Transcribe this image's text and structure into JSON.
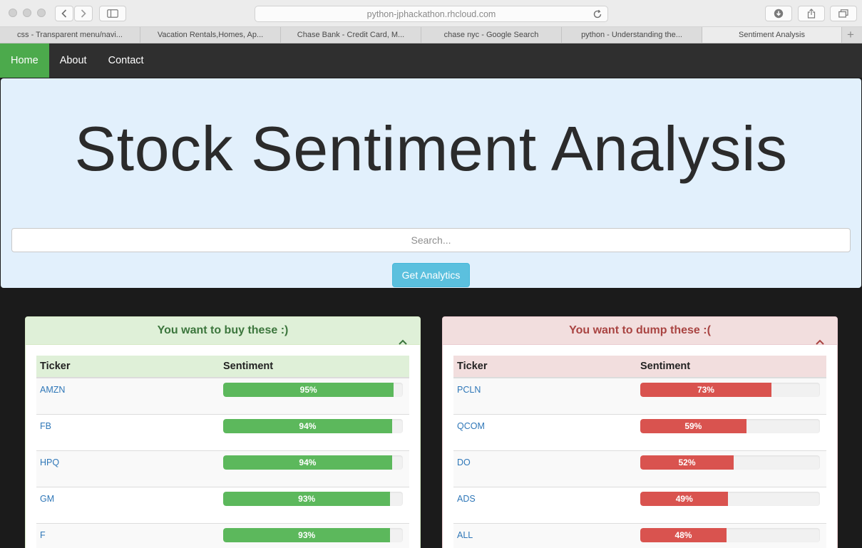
{
  "browser": {
    "url": "python-jphackathon.rhcloud.com",
    "tabs": [
      {
        "label": "css - Transparent menu/navi..."
      },
      {
        "label": "Vacation Rentals,Homes, Ap..."
      },
      {
        "label": "Chase Bank - Credit Card, M..."
      },
      {
        "label": "chase nyc - Google Search"
      },
      {
        "label": "python - Understanding the..."
      },
      {
        "label": "Sentiment Analysis"
      }
    ],
    "new_tab": "+"
  },
  "nav": {
    "items": [
      {
        "label": "Home"
      },
      {
        "label": "About"
      },
      {
        "label": "Contact"
      }
    ]
  },
  "hero": {
    "title": "Stock Sentiment Analysis",
    "search_placeholder": "Search...",
    "button_label": "Get Analytics"
  },
  "buy_panel": {
    "title": "You want to buy these :)",
    "col_ticker": "Ticker",
    "col_sentiment": "Sentiment",
    "color": "#5cb85c",
    "rows": [
      {
        "ticker": "AMZN",
        "pct": 95,
        "label": "95%"
      },
      {
        "ticker": "FB",
        "pct": 94,
        "label": "94%"
      },
      {
        "ticker": "HPQ",
        "pct": 94,
        "label": "94%"
      },
      {
        "ticker": "GM",
        "pct": 93,
        "label": "93%"
      },
      {
        "ticker": "F",
        "pct": 93,
        "label": "93%"
      }
    ]
  },
  "dump_panel": {
    "title": "You want to dump these :(",
    "col_ticker": "Ticker",
    "col_sentiment": "Sentiment",
    "color": "#d9534f",
    "rows": [
      {
        "ticker": "PCLN",
        "pct": 73,
        "label": "73%"
      },
      {
        "ticker": "QCOM",
        "pct": 59,
        "label": "59%"
      },
      {
        "ticker": "DO",
        "pct": 52,
        "label": "52%"
      },
      {
        "ticker": "ADS",
        "pct": 49,
        "label": "49%"
      },
      {
        "ticker": "ALL",
        "pct": 48,
        "label": "48%"
      }
    ]
  }
}
